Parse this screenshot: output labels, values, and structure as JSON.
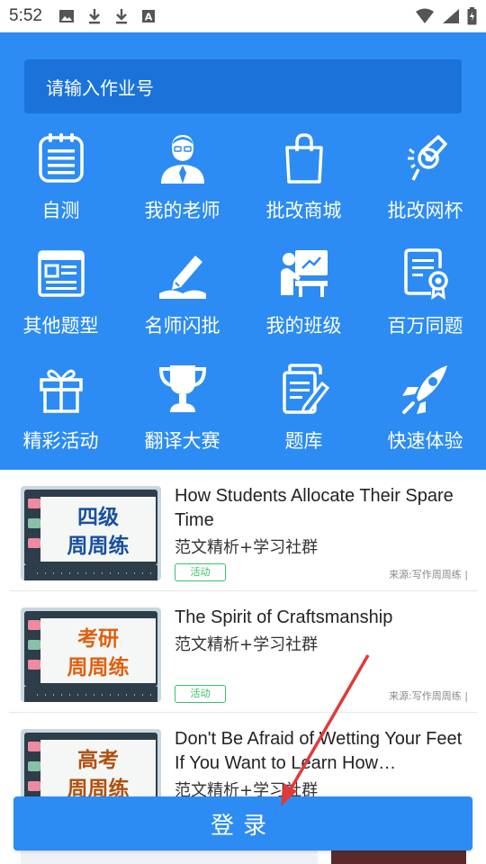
{
  "status_bar": {
    "time": "5:52"
  },
  "search": {
    "placeholder": "请输入作业号"
  },
  "features": [
    {
      "label": "自测",
      "icon": "notepad-icon"
    },
    {
      "label": "我的老师",
      "icon": "teacher-icon"
    },
    {
      "label": "批改商城",
      "icon": "shopping-bag-icon"
    },
    {
      "label": "批改网杯",
      "icon": "trophy-cup-icon"
    },
    {
      "label": "其他题型",
      "icon": "browser-window-icon"
    },
    {
      "label": "名师闪批",
      "icon": "pen-book-icon"
    },
    {
      "label": "我的班级",
      "icon": "classroom-icon"
    },
    {
      "label": "百万同题",
      "icon": "certificate-icon"
    },
    {
      "label": "精彩活动",
      "icon": "gift-icon"
    },
    {
      "label": "翻译大赛",
      "icon": "trophy-icon"
    },
    {
      "label": "题库",
      "icon": "documents-icon"
    },
    {
      "label": "快速体验",
      "icon": "rocket-icon"
    }
  ],
  "articles": [
    {
      "title": "How Students Allocate Their Spare Time",
      "subtitle": "范文精析+学习社群",
      "tag": "活动",
      "source": "来源:写作周周练 |",
      "thumb_line1": "四级",
      "thumb_line2": "周周练",
      "thumb_color1": "#1a4fa0",
      "thumb_color2": "#1a4fa0"
    },
    {
      "title": "The Spirit of Craftsmanship",
      "subtitle": "范文精析+学习社群",
      "tag": "活动",
      "source": "来源:写作周周练 |",
      "thumb_line1": "考研",
      "thumb_line2": "周周练",
      "thumb_color1": "#e06010",
      "thumb_color2": "#e06010"
    },
    {
      "title": "Don't Be Afraid of Wetting Your Feet If You Want to Learn How…",
      "subtitle": "范文精析+学习社群",
      "tag": "",
      "source": "",
      "thumb_line1": "高考",
      "thumb_line2": "周周练",
      "thumb_color1": "#b05010",
      "thumb_color2": "#b05010"
    }
  ],
  "login": {
    "label": "登录"
  },
  "colors": {
    "primary": "#2c8cf3",
    "search_bg": "#1b73d9",
    "tag_green": "#3ac06a"
  }
}
